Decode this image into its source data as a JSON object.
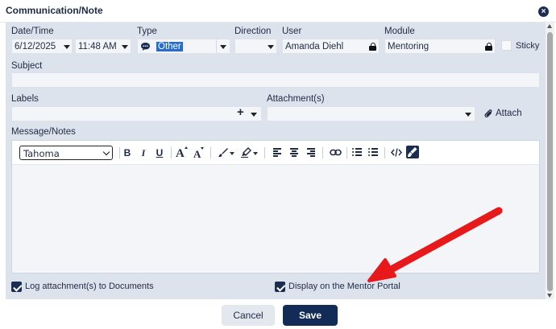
{
  "dialog": {
    "title": "Communication/Note",
    "close_icon": "close-icon"
  },
  "fields": {
    "date_time_label": "Date/Time",
    "date_value": "6/12/2025",
    "time_value": "11:48 AM",
    "type_label": "Type",
    "type_value": "Other",
    "type_icon": "chat-bubble-icon",
    "direction_label": "Direction",
    "direction_value": "",
    "user_label": "User",
    "user_value": "Amanda Diehl",
    "module_label": "Module",
    "module_value": "Mentoring",
    "sticky_label": "Sticky",
    "subject_label": "Subject",
    "subject_value": "",
    "labels_label": "Labels",
    "labels_add": "+",
    "attachments_label": "Attachment(s)",
    "attach_button": "Attach",
    "message_label": "Message/Notes"
  },
  "editor": {
    "font_family": "Tahoma",
    "bold": "B",
    "italic": "I",
    "underline": "U",
    "body_text": ""
  },
  "options": {
    "log_attachments_label": "Log attachment(s) to Documents",
    "log_attachments_checked": true,
    "display_portal_label": "Display on the Mentor Portal",
    "display_portal_checked": true,
    "sticky_checked": false
  },
  "footer": {
    "cancel_label": "Cancel",
    "save_label": "Save"
  },
  "annotation": {
    "arrow_color": "#e8191a"
  },
  "colors": {
    "navy": "#132c57",
    "panel": "#dde3ec",
    "selection": "#2c6bc7"
  }
}
